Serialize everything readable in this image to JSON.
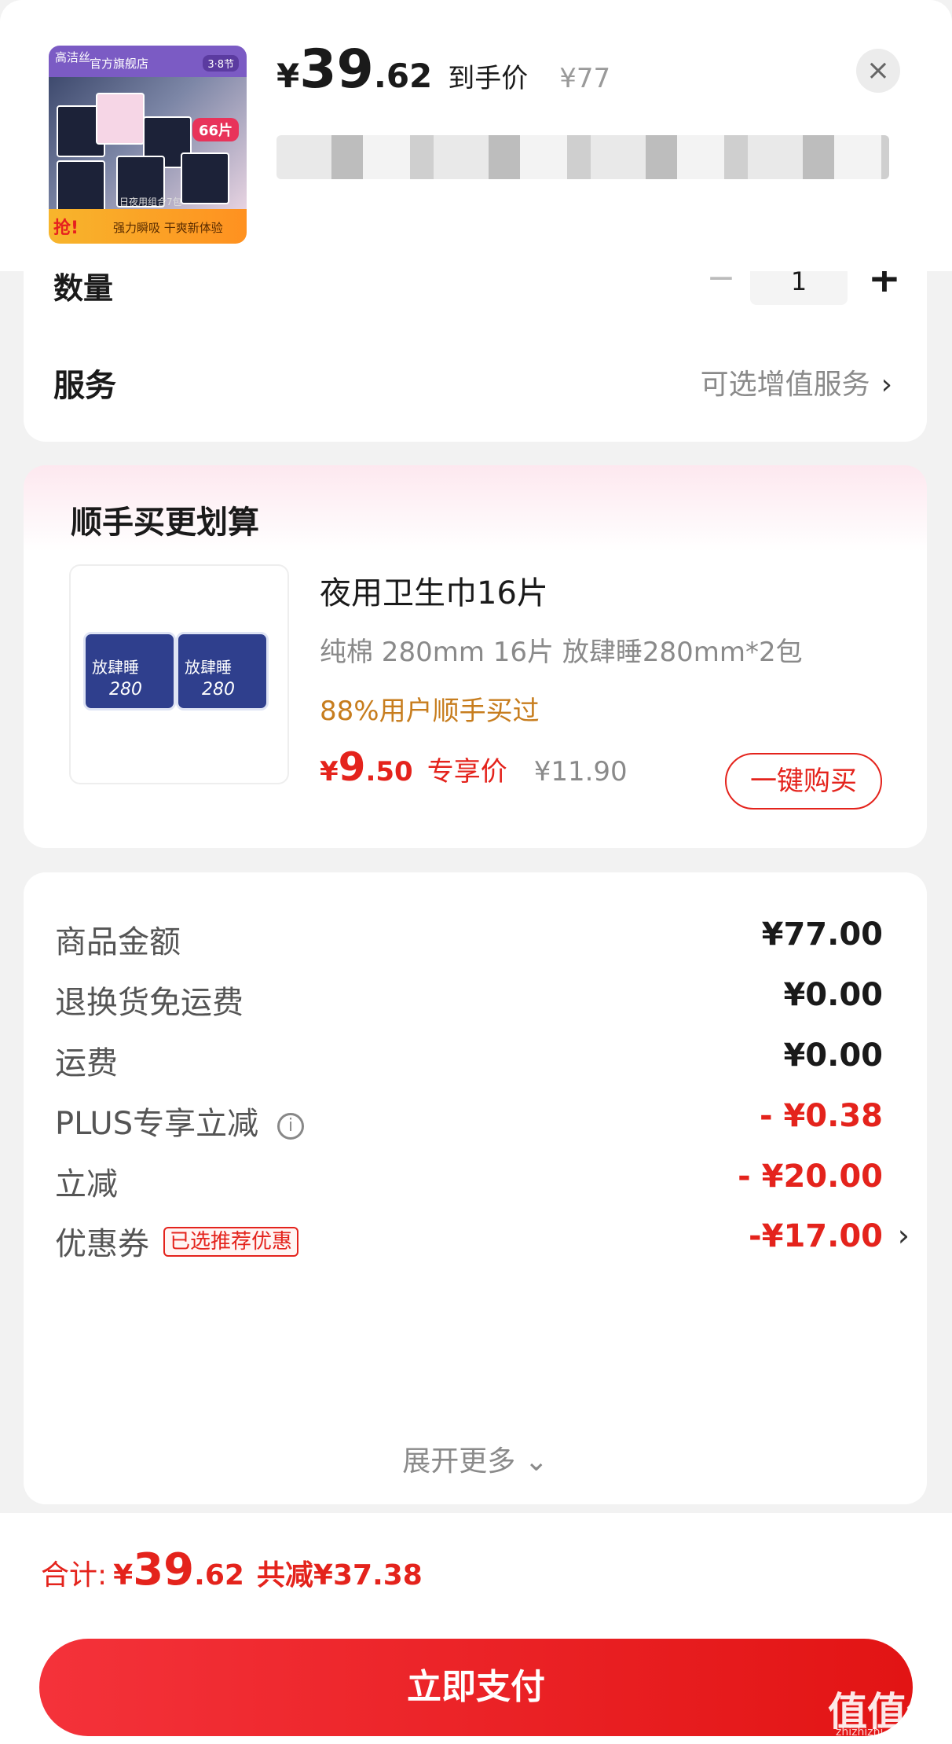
{
  "product_thumb": {
    "brand": "高洁丝",
    "store": "官方旗舰店",
    "festival": "3·8节",
    "count_badge": "66片",
    "note": "日夜用组合7包",
    "grab": "抢!",
    "slogan": "强力瞬吸 干爽新体验"
  },
  "header": {
    "currency": "¥",
    "price_int": "39",
    "price_dec": ".62",
    "price_tag": "到手价",
    "orig_price": "¥77"
  },
  "quantity": {
    "label": "数量",
    "value": "1",
    "minus": "−",
    "plus": "+"
  },
  "service": {
    "label": "服务",
    "value": "可选增值服务",
    "chevron": "›"
  },
  "bundle": {
    "title": "顺手买更划算",
    "pkg_text": "放肆睡",
    "pkg_size": "280",
    "name": "夜用卫生巾16片",
    "spec": "纯棉 280mm 16片 放肆睡280mm*2包",
    "social": "88%用户顺手买过",
    "currency": "¥",
    "price_int": "9",
    "price_dec": ".50",
    "price_tag": "专享价",
    "orig_price": "¥11.90",
    "buy_label": "一键购买"
  },
  "summary": {
    "rows": [
      {
        "label": "商品金额",
        "value": "¥77.00"
      },
      {
        "label": "退换货免运费",
        "value": "¥0.00"
      },
      {
        "label": "运费",
        "value": "¥0.00"
      },
      {
        "label": "PLUS专享立减",
        "value": "- ¥0.38"
      },
      {
        "label": "立减",
        "value": "- ¥20.00"
      },
      {
        "label": "优惠券",
        "badge": "已选推荐优惠",
        "value": "-¥17.00"
      }
    ],
    "expand": "展开更多 ⌄"
  },
  "footer": {
    "total_label": "合计:",
    "currency": "¥",
    "total_int": "39",
    "total_dec": ".62",
    "savings": "共减¥37.38",
    "pay_label": "立即支付"
  },
  "watermark": {
    "text": "值值值",
    "url": "zhizhizhi.com"
  },
  "colors": {
    "accent": "#e4231c",
    "social": "#c77d1e",
    "muted": "#8a8a8a"
  }
}
